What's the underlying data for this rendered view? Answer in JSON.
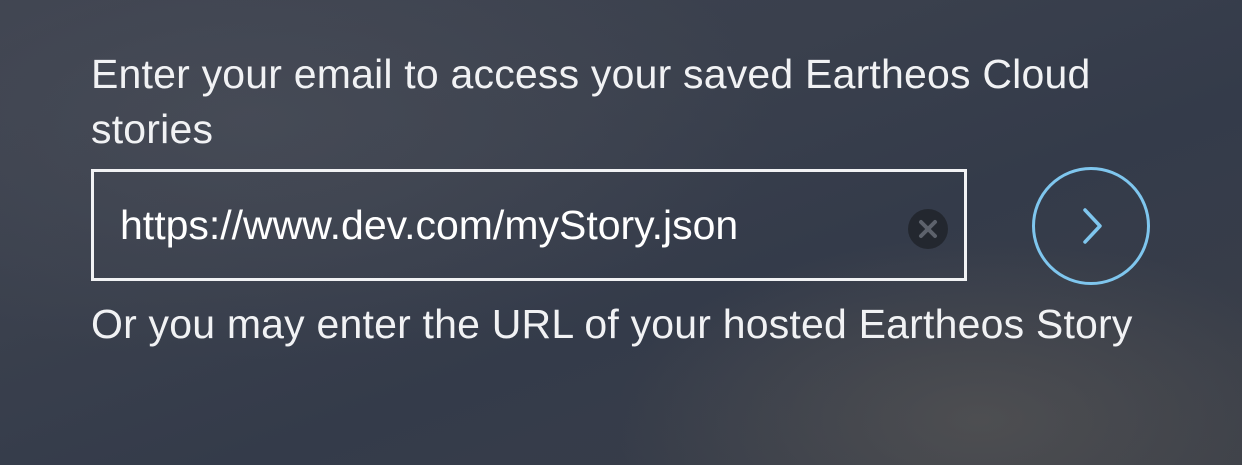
{
  "prompts": {
    "email_text": "Enter your email to access your saved Eartheos Cloud stories",
    "url_text": "Or you may enter the URL of your hosted Eartheos Story"
  },
  "url_field": {
    "value": "https://www.dev.com/myStory.json"
  },
  "icons": {
    "clear": "clear-icon",
    "submit": "chevron-right-icon"
  },
  "colors": {
    "accent": "#7fc6ee",
    "text": "#f1f2f4",
    "clear_button_bg": "#23272f"
  }
}
